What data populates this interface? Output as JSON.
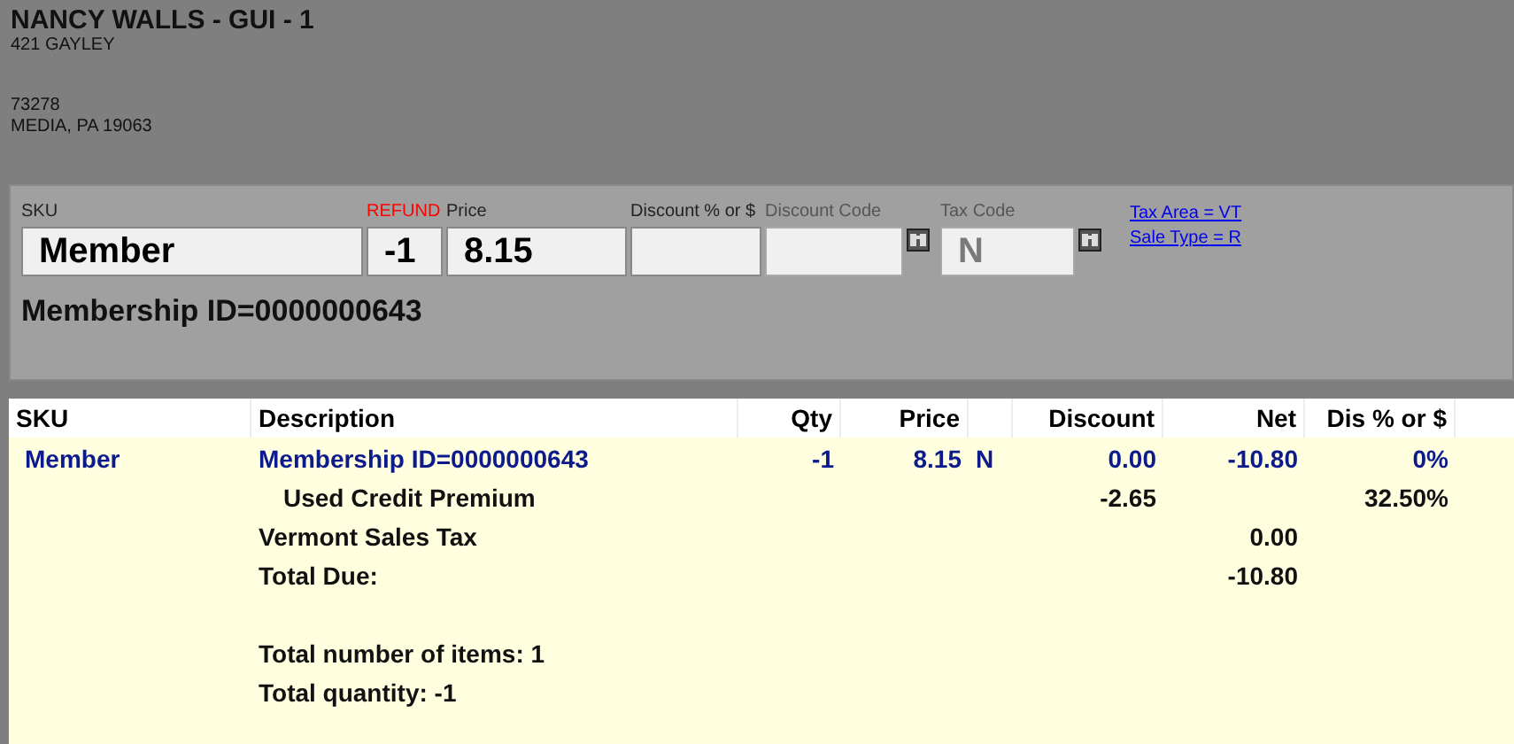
{
  "customer": {
    "name": "NANCY WALLS - GUI - 1",
    "address_lines": [
      "421 GAYLEY"
    ],
    "account_lines": [
      "73278",
      "MEDIA, PA 19063"
    ]
  },
  "entry": {
    "fields": [
      {
        "kind": "sku",
        "label": "SKU",
        "value": "Member",
        "disabled": false
      },
      {
        "kind": "qty",
        "flag": "REFUND",
        "value": "-1",
        "disabled": false
      },
      {
        "kind": "price",
        "label": "Price",
        "value": "8.15",
        "disabled": false
      },
      {
        "kind": "discount",
        "label": "Discount % or $",
        "disabled": false
      },
      {
        "kind": "code",
        "label": "Discount Code",
        "disabled": true,
        "lookup": true
      },
      {
        "kind": "tax",
        "label": "Tax Code",
        "value": "N",
        "disabled": true,
        "lookup": true
      }
    ],
    "links": [
      "Tax Area = VT",
      "Sale Type = R"
    ],
    "description": "Membership ID=0000000643"
  },
  "table": {
    "columns": [
      "SKU",
      "Description",
      "Qty",
      "Price",
      "Discount",
      "Net",
      "Dis % or $"
    ],
    "rows": [
      {
        "kind": "item",
        "sku": "Member",
        "description": "Membership ID=0000000643",
        "qty": "-1",
        "price": "8.15",
        "tax": "N",
        "discount": "0.00",
        "net": "-10.80",
        "dis": "0%"
      },
      {
        "kind": "sub",
        "description": "Used Credit Premium",
        "discount": "-2.65",
        "dis": "32.50%"
      },
      {
        "kind": "total",
        "description": "Vermont Sales Tax",
        "net": "0.00"
      },
      {
        "kind": "total",
        "description": "Total Due:",
        "net": "-10.80"
      },
      {
        "kind": "blank"
      },
      {
        "kind": "total",
        "description": "Total number of items: 1"
      },
      {
        "kind": "total",
        "description": "Total quantity: -1"
      }
    ]
  }
}
